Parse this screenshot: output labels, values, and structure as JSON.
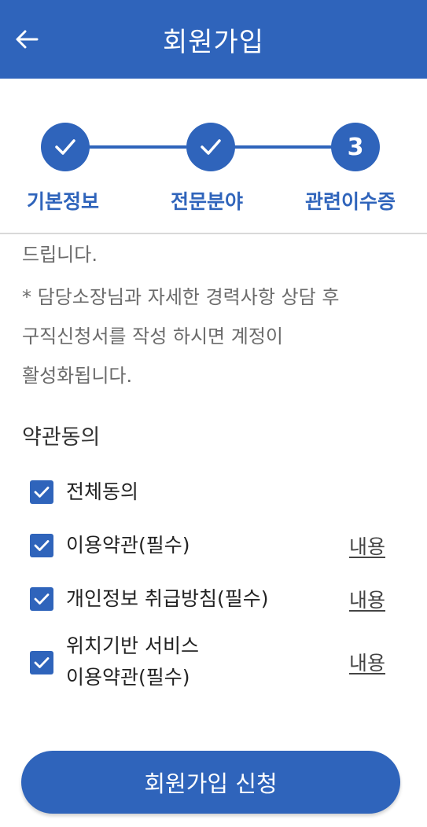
{
  "header": {
    "title": "회원가입",
    "back_icon": "arrow-left-icon"
  },
  "stepper": {
    "steps": [
      {
        "label": "기본정보",
        "state": "done",
        "marker": ""
      },
      {
        "label": "전문분야",
        "state": "done",
        "marker": ""
      },
      {
        "label": "관련이수증",
        "state": "current",
        "marker": "3"
      }
    ]
  },
  "notice": {
    "lines": [
      "드립니다.",
      "* 담당소장님과 자세한 경력사항 상담 후",
      "구직신청서를 작성 하시면 계정이",
      "활성화됩니다."
    ]
  },
  "terms": {
    "title": "약관동의",
    "items": [
      {
        "label": "전체동의",
        "checked": true,
        "link": ""
      },
      {
        "label": "이용약관(필수)",
        "checked": true,
        "link": "내용"
      },
      {
        "label": "개인정보 취급방침(필수)",
        "checked": true,
        "link": "내용"
      },
      {
        "label_line1": "위치기반 서비스",
        "label_line2": "이용약관(필수)",
        "checked": true,
        "link": "내용"
      }
    ]
  },
  "submit": {
    "label": "회원가입 신청"
  },
  "colors": {
    "primary": "#2f64bb",
    "muted_text": "#6b6b6b"
  }
}
